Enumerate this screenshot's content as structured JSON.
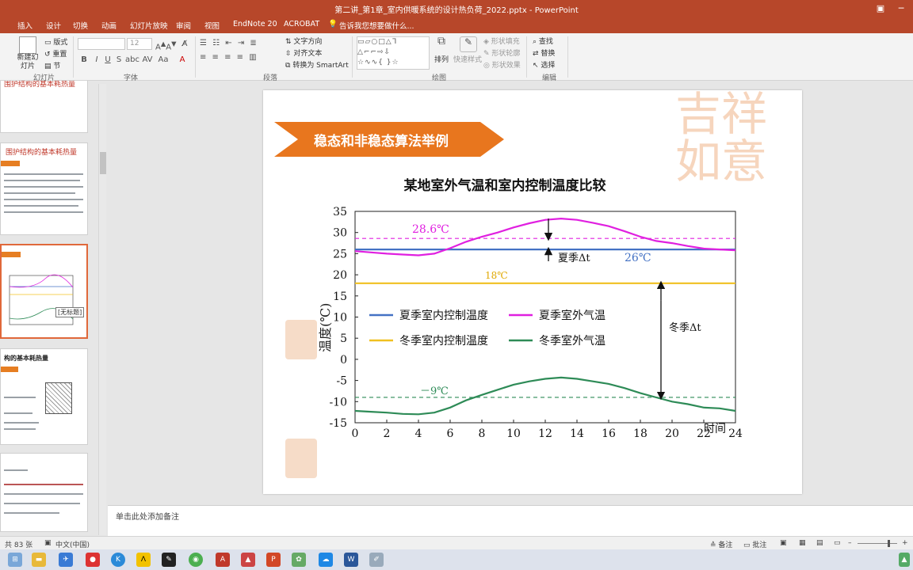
{
  "window": {
    "title": "第二讲_第1章_室内供暖系统的设计热负荷_2022.pptx - PowerPoint"
  },
  "tabs": [
    "插入",
    "设计",
    "切换",
    "动画",
    "幻灯片放映",
    "审阅",
    "视图",
    "EndNote 20",
    "ACROBAT"
  ],
  "tell_me": "告诉我您想要做什么...",
  "ribbon": {
    "slides_group": {
      "new_slide": "新建幻灯片",
      "layout": "版式",
      "reset": "重置",
      "section": "节",
      "label": "幻灯片"
    },
    "font_group": {
      "font_size": "12",
      "label": "字体"
    },
    "paragraph_group": {
      "text_direction": "文字方向",
      "align_text": "对齐文本",
      "smartart": "转换为 SmartArt",
      "label": "段落"
    },
    "drawing_group": {
      "arrange": "排列",
      "quick_styles": "快速样式",
      "shape_fill": "形状填充",
      "shape_outline": "形状轮廓",
      "shape_effects": "形状效果",
      "label": "绘图"
    },
    "editing_group": {
      "find": "查找",
      "replace": "替换",
      "select": "选择",
      "label": "编辑"
    }
  },
  "thumbnails": {
    "t1_title": "围护结构的基本耗热量",
    "t2_title": "围护结构的基本耗热量",
    "t3_popup": "[无标题]",
    "t4_title": "构的基本耗热量"
  },
  "slide": {
    "banner": "稳态和非稳态算法举例",
    "chart_title": "某地室外气温和室内控制温度比较",
    "annotations": {
      "label_286": "28.6℃",
      "label_26": "26℃",
      "label_18": "18℃",
      "label_m9": "－9℃",
      "summer_dt": "夏季Δt",
      "winter_dt": "冬季Δt"
    }
  },
  "chart_data": {
    "type": "line",
    "title": "某地室外气温和室内控制温度比较",
    "xlabel": "时间",
    "ylabel": "温度(℃)",
    "xlim": [
      0,
      24
    ],
    "ylim": [
      -15,
      35
    ],
    "x_ticks": [
      0,
      2,
      4,
      6,
      8,
      10,
      12,
      14,
      16,
      18,
      20,
      22,
      24
    ],
    "y_ticks": [
      35,
      30,
      25,
      20,
      15,
      10,
      5,
      0,
      -5,
      -10,
      -15
    ],
    "legend_position": "center-left",
    "series": [
      {
        "name": "夏季室内控制温度",
        "color": "#4472c4",
        "style": "solid",
        "x": [
          0,
          24
        ],
        "y": [
          26,
          26
        ]
      },
      {
        "name": "夏季室外气温",
        "color": "#e020e0",
        "style": "solid",
        "x": [
          0,
          1,
          2,
          3,
          4,
          5,
          6,
          7,
          8,
          9,
          10,
          11,
          12,
          13,
          14,
          15,
          16,
          17,
          18,
          19,
          20,
          21,
          22,
          23,
          24
        ],
        "y": [
          25.6,
          25.3,
          25.0,
          24.8,
          24.6,
          25.0,
          26.3,
          27.8,
          29.0,
          30.0,
          31.2,
          32.2,
          33.0,
          33.3,
          33.0,
          32.3,
          31.5,
          30.3,
          29.0,
          28.0,
          27.5,
          26.8,
          26.2,
          26.0,
          25.8
        ]
      },
      {
        "name": "冬季室内控制温度",
        "color": "#f0c020",
        "style": "solid",
        "x": [
          0,
          24
        ],
        "y": [
          18,
          18
        ]
      },
      {
        "name": "冬季室外气温",
        "color": "#2e8b57",
        "style": "solid",
        "x": [
          0,
          1,
          2,
          3,
          4,
          5,
          6,
          7,
          8,
          9,
          10,
          11,
          12,
          13,
          14,
          15,
          16,
          17,
          18,
          19,
          20,
          21,
          22,
          23,
          24
        ],
        "y": [
          -12.2,
          -12.4,
          -12.6,
          -12.9,
          -13.0,
          -12.6,
          -11.4,
          -9.7,
          -8.4,
          -7.2,
          -6.0,
          -5.2,
          -4.6,
          -4.3,
          -4.6,
          -5.2,
          -5.8,
          -6.8,
          -8.0,
          -9.0,
          -10.0,
          -10.6,
          -11.4,
          -11.6,
          -12.2
        ]
      }
    ],
    "reference_lines": [
      {
        "y": 28.6,
        "color": "#e020e0",
        "style": "dashed"
      },
      {
        "y": -9,
        "color": "#2e8b57",
        "style": "dashed"
      }
    ]
  },
  "notes_placeholder": "单击此处添加备注",
  "status": {
    "slide_count": "共 83 张",
    "language": "中文(中国)",
    "notes_button": "备注",
    "comments_button": "批注"
  }
}
